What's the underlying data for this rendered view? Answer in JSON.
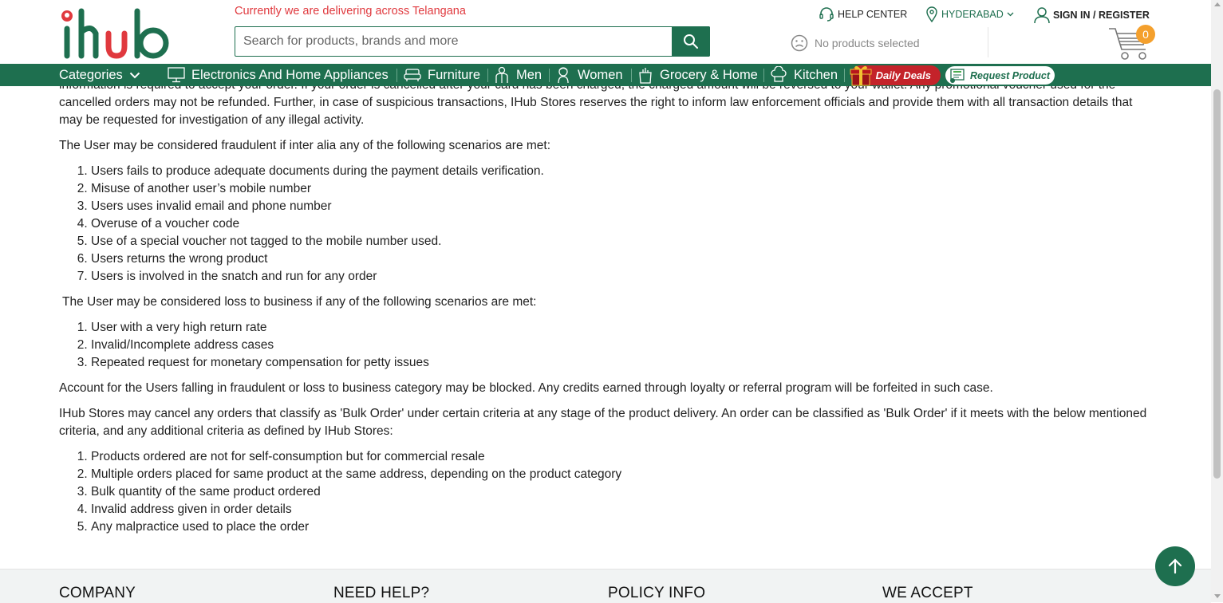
{
  "header": {
    "logo_text": "iHUB",
    "delivery_notice": "Currently we are delivering across Telangana",
    "search_placeholder": "Search for products, brands and more",
    "help_center": "HELP CENTER",
    "city": "HYDERABAD",
    "sign_in": "SIGN IN / REGISTER",
    "compare_text": "No products selected",
    "cart_count": "0"
  },
  "nav": {
    "categories": "Categories",
    "items": [
      "Electronics And Home Appliances",
      "Furniture",
      "Men",
      "Women",
      "Grocery & Home",
      "Kitchen"
    ],
    "daily_deals": "Daily Deals",
    "request_product": "Request Product"
  },
  "content": {
    "intro_partial": "information is required to accept your order. If your order is cancelled after your card has been charged, the charged amount will be reversed to your wallet. Any promotional voucher used for the cancelled orders may not be refunded. Further, in case of suspicious transactions, IHub Stores reserves the right to inform law enforcement officials and provide them with all transaction details that may be requested for investigation of any illegal activity.",
    "fraud_heading": "The User may be considered fraudulent if inter alia any of the following scenarios are met:",
    "fraud_items": [
      "Users fails to produce adequate documents during the payment details verification.",
      "Misuse of another user’s mobile number",
      "Users uses invalid email and phone number",
      "Overuse of a voucher code",
      "Use of a special voucher not tagged to the mobile number used.",
      "Users returns the wrong product",
      "Users is involved in the snatch and run for any order"
    ],
    "loss_heading": " The User may be considered loss to business if any of the following scenarios are met:",
    "loss_items": [
      "User with a very high return rate",
      "Invalid/Incomplete address cases",
      "Repeated request for monetary compensation for petty issues"
    ],
    "blocked_text": "Account for the Users falling in fraudulent or loss to business category may be blocked. Any credits earned through loyalty or referral program will be forfeited in such case.",
    "bulk_heading": "IHub Stores may cancel any orders that classify as 'Bulk Order' under certain criteria at any stage of the product delivery. An order can be classified as 'Bulk Order' if it meets with the below mentioned criteria, and any additional criteria as defined by IHub Stores:",
    "bulk_items": [
      "Products ordered are not for self-consumption but for commercial resale",
      "Multiple orders placed for same product at the same address, depending on the product category",
      "Bulk quantity of the same product ordered",
      "Invalid address given in order details",
      "Any malpractice used to place the order"
    ]
  },
  "footer": {
    "company": "COMPANY",
    "need_help": "NEED HELP?",
    "policy_info": "POLICY INFO",
    "we_accept": "WE ACCEPT"
  },
  "colors": {
    "brand_green": "#1e6f4f",
    "accent_red": "#e0393e",
    "deals_red": "#c4232a",
    "badge_orange": "#f4a02d"
  }
}
